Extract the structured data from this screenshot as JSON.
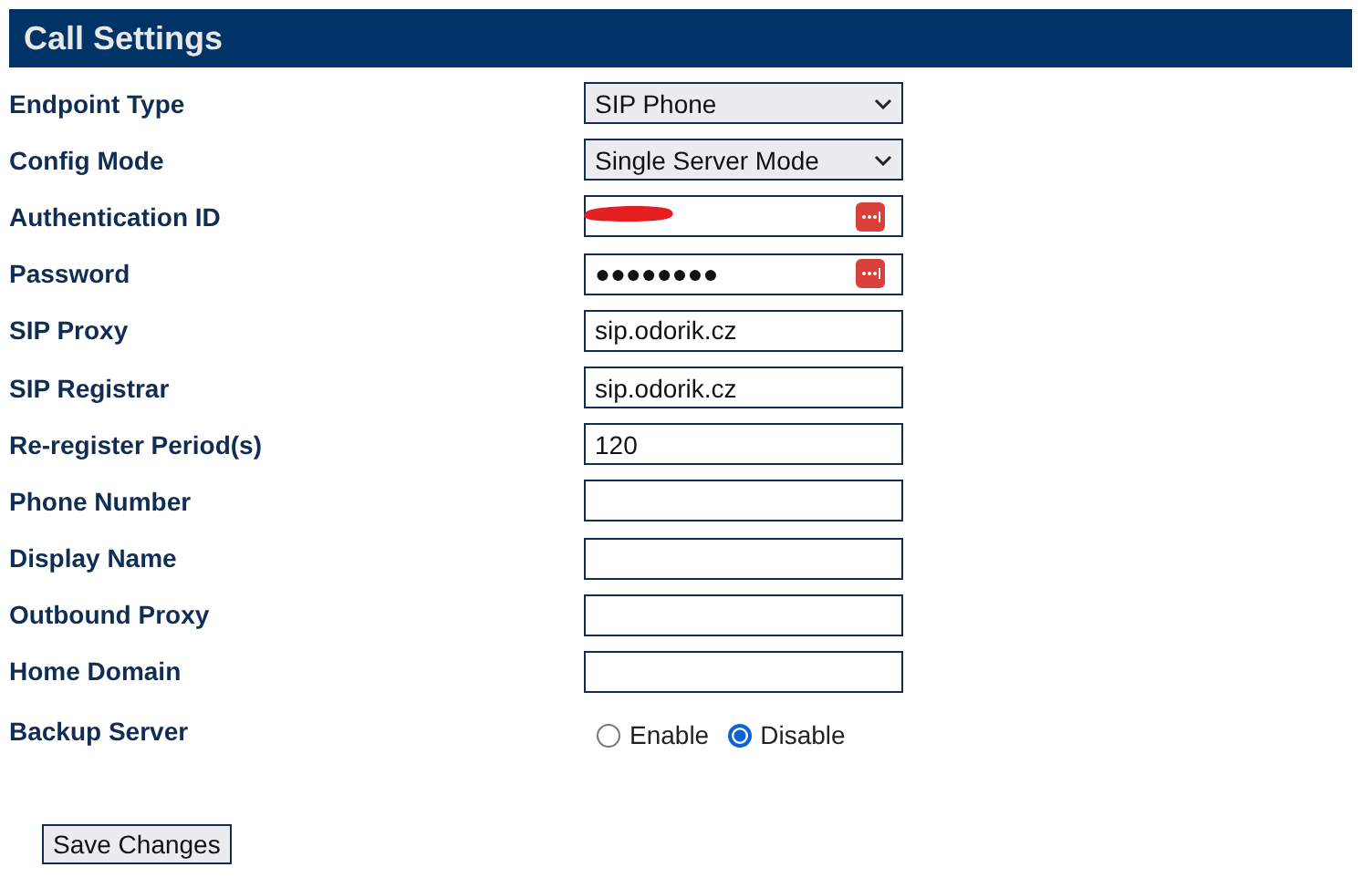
{
  "title": "Call Settings",
  "fields": [
    {
      "label": "Endpoint Type",
      "kind": "select",
      "value": "SIP Phone"
    },
    {
      "label": "Config Mode",
      "kind": "select",
      "value": "Single Server Mode"
    },
    {
      "label": "Authentication ID",
      "kind": "text",
      "redacted": true,
      "autofill": true
    },
    {
      "label": "Password",
      "kind": "text",
      "value": "●●●●●●●●",
      "autofill": true
    },
    {
      "label": "SIP Proxy",
      "kind": "text",
      "value": "sip.odorik.cz"
    },
    {
      "label": "SIP Registrar",
      "kind": "text",
      "value": "sip.odorik.cz"
    },
    {
      "label": "Re-register Period(s)",
      "kind": "text",
      "value": "120"
    },
    {
      "label": "Phone Number",
      "kind": "text"
    },
    {
      "label": "Display Name",
      "kind": "text"
    },
    {
      "label": "Outbound Proxy",
      "kind": "text"
    },
    {
      "label": "Home Domain",
      "kind": "text"
    },
    {
      "label": "Backup Server",
      "kind": "radio",
      "options": [
        {
          "label": "Enable",
          "selected": false
        },
        {
          "label": "Disable",
          "selected": true
        }
      ]
    }
  ],
  "save_button": "Save Changes"
}
